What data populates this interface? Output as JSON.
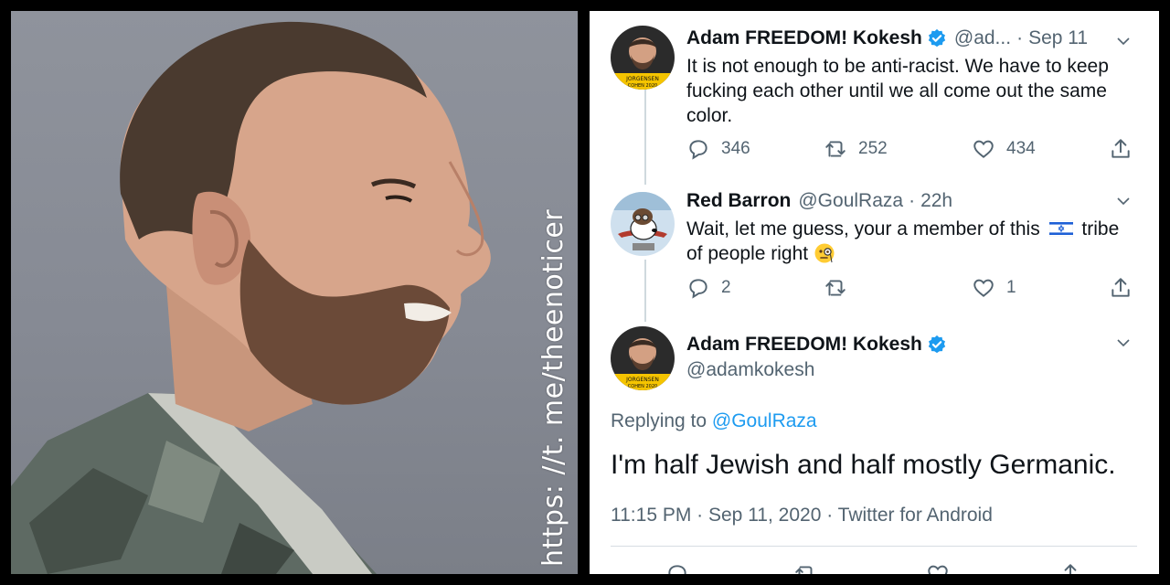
{
  "watermark": "https: //t. me/theenoticer",
  "colors": {
    "verified": "#1d9bf0",
    "link": "#1d9bf0",
    "secondary_text": "#536471",
    "primary_text": "#0f1419"
  },
  "tweets": [
    {
      "name": "Adam FREEDOM! Kokesh",
      "verified": true,
      "handle": "@ad...",
      "time": "Sep 11",
      "avatar_text": [
        "JORGENSEN",
        "COHEN 2020"
      ],
      "lines": [
        "It is not enough to be anti-racist. We have to keep",
        "fucking each other until we all come out the same",
        "color."
      ],
      "replies": "346",
      "retweets": "252",
      "likes": "434"
    },
    {
      "name": "Red Barron",
      "handle": "@GoulRaza",
      "time": "22h",
      "lines": [
        "Wait, let me guess, your a member of this",
        "tribe",
        "of people right"
      ],
      "emoji": [
        "israel-flag",
        "face-with-monocle"
      ],
      "replies": "2",
      "retweets": "",
      "likes": "1"
    }
  ],
  "main_tweet": {
    "name": "Adam FREEDOM! Kokesh",
    "verified": true,
    "handle": "@adamkokesh",
    "avatar_text": [
      "JORGENSEN",
      "COHEN 2020"
    ],
    "replying_prefix": "Replying to",
    "replying_to": "@GoulRaza",
    "text": "I'm half Jewish and half mostly Germanic.",
    "timestamp": "11:15 PM · Sep 11, 2020 · Twitter for Android"
  }
}
